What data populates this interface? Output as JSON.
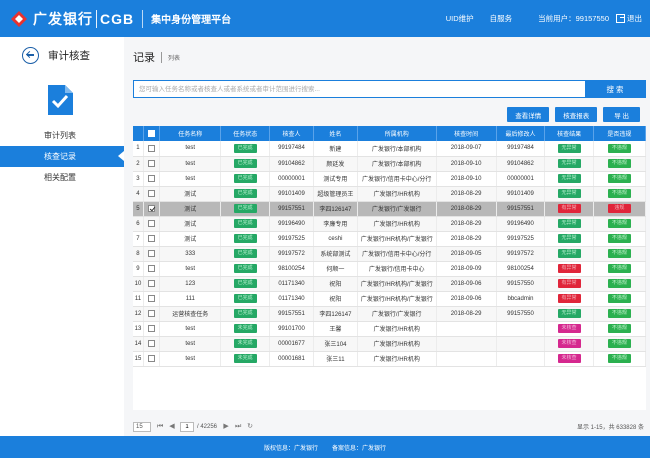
{
  "header": {
    "brand_cn": "广发银行",
    "brand_en": "CGB",
    "app_title": "集中身份管理平台",
    "link_uid": "UID维护",
    "link_self": "自服务",
    "user_info": "当前用户：99157550",
    "logout": "退出"
  },
  "sidebar": {
    "module_title": "审计核查",
    "items": [
      {
        "label": "审计列表"
      },
      {
        "label": "核查记录"
      },
      {
        "label": "相关配置"
      }
    ]
  },
  "page": {
    "title": "记录",
    "subtitle": "列表"
  },
  "search": {
    "placeholder": "您可输入任务名称或者核查人或者系统或者审计范围进行搜索...",
    "button": "搜 索"
  },
  "toolbar": {
    "detail": "查看详情",
    "report": "核查报表",
    "export": "导 出"
  },
  "table": {
    "headers": [
      "",
      "任务名称",
      "任务状态",
      "核查人",
      "姓名",
      "所属机构",
      "核查时间",
      "最后修改人",
      "核查结果",
      "是否违规"
    ],
    "rows": [
      {
        "no": "1",
        "task": "test",
        "status": "已完成",
        "checker": "99197484",
        "name": "新建",
        "org": "广发银行/本部机构",
        "time": "2018-09-07",
        "modifier": "99197484",
        "result": "无异常",
        "violation": "不违规"
      },
      {
        "no": "2",
        "task": "test",
        "status": "已完成",
        "checker": "99104862",
        "name": "颜廷发",
        "org": "广发银行/本部机构",
        "time": "2018-09-10",
        "modifier": "99104862",
        "result": "无异常",
        "violation": "不违规"
      },
      {
        "no": "3",
        "task": "test",
        "status": "已完成",
        "checker": "00000001",
        "name": "测试专用",
        "org": "广发银行/信用卡中心/分行",
        "time": "2018-09-10",
        "modifier": "00000001",
        "result": "无异常",
        "violation": "不违规"
      },
      {
        "no": "4",
        "task": "测试",
        "status": "已完成",
        "checker": "99101409",
        "name": "超级管理员王",
        "org": "广发银行/HR机构",
        "time": "2018-08-29",
        "modifier": "99101409",
        "result": "无异常",
        "violation": "不违规"
      },
      {
        "no": "5",
        "task": "测试",
        "status": "已完成",
        "checker": "99157551",
        "name": "李四126147",
        "org": "广发银行/广发银行",
        "time": "2018-08-29",
        "modifier": "99157551",
        "result": "有异常",
        "violation": "违规"
      },
      {
        "no": "6",
        "task": "测试",
        "status": "已完成",
        "checker": "99196490",
        "name": "李廉专用",
        "org": "广发银行/HR机构",
        "time": "2018-08-29",
        "modifier": "99196490",
        "result": "无异常",
        "violation": "不违规"
      },
      {
        "no": "7",
        "task": "测试",
        "status": "已完成",
        "checker": "99197525",
        "name": "ceshi",
        "org": "广发银行/HR机构/广发银行",
        "time": "2018-08-29",
        "modifier": "99197525",
        "result": "无异常",
        "violation": "不违规"
      },
      {
        "no": "8",
        "task": "333",
        "status": "已完成",
        "checker": "99197572",
        "name": "系统部测试",
        "org": "广发银行/信用卡中心/分行",
        "time": "2018-09-05",
        "modifier": "99197572",
        "result": "无异常",
        "violation": "不违规"
      },
      {
        "no": "9",
        "task": "test",
        "status": "已完成",
        "checker": "98100254",
        "name": "何顺一",
        "org": "广发银行/信用卡中心",
        "time": "2018-09-09",
        "modifier": "98100254",
        "result": "有异常",
        "violation": "不违规"
      },
      {
        "no": "10",
        "task": "123",
        "status": "已完成",
        "checker": "01171340",
        "name": "祝阳",
        "org": "广发银行/HR机构/广发银行",
        "time": "2018-09-06",
        "modifier": "99157550",
        "result": "有异常",
        "violation": "不违规"
      },
      {
        "no": "11",
        "task": "111",
        "status": "已完成",
        "checker": "01171340",
        "name": "祝阳",
        "org": "广发银行/HR机构/广发银行",
        "time": "2018-09-06",
        "modifier": "bbcadmin",
        "result": "有异常",
        "violation": "不违规"
      },
      {
        "no": "12",
        "task": "运营核查任务",
        "status": "已完成",
        "checker": "99157551",
        "name": "李四126147",
        "org": "广发银行/广发银行",
        "time": "2018-08-29",
        "modifier": "99157550",
        "result": "无异常",
        "violation": "不违规"
      },
      {
        "no": "13",
        "task": "test",
        "status": "未完成",
        "checker": "99101700",
        "name": "王馨",
        "org": "广发银行/HR机构",
        "time": "",
        "modifier": "",
        "result": "未核查",
        "violation": "不违规"
      },
      {
        "no": "14",
        "task": "test",
        "status": "未完成",
        "checker": "00001677",
        "name": "张三104",
        "org": "广发银行/HR机构",
        "time": "",
        "modifier": "",
        "result": "未核查",
        "violation": "不违规"
      },
      {
        "no": "15",
        "task": "test",
        "status": "未完成",
        "checker": "00001681",
        "name": "张三11",
        "org": "广发银行/HR机构",
        "time": "",
        "modifier": "",
        "result": "未核查",
        "violation": "不违规"
      }
    ]
  },
  "pager": {
    "page_size": "15",
    "current_page": "1",
    "total_pages": "/ 42256",
    "summary": "显示 1-15，共 633828 条"
  },
  "footer": {
    "copyright": "版权信息：广发银行",
    "record": "备案信息：广发银行"
  },
  "colors": {
    "primary": "#1b7fdc",
    "status_green": "#25a865",
    "result_red": "#e0253a",
    "result_magenta": "#d5288e"
  }
}
